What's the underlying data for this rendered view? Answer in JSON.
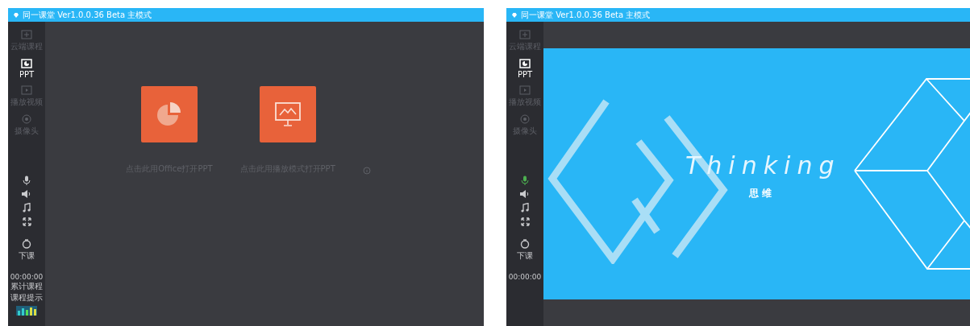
{
  "windows": [
    {
      "title": "同一课堂 Ver1.0.0.36 Beta  主模式",
      "sidebar": {
        "items": [
          {
            "label": "云端课程",
            "kind": "cloud",
            "selected": false
          },
          {
            "label": "PPT",
            "kind": "ppt",
            "selected": true
          },
          {
            "label": "播放视频",
            "kind": "video",
            "selected": false
          },
          {
            "label": "摄像头",
            "kind": "camera",
            "selected": false
          }
        ],
        "tools": [
          {
            "kind": "mic",
            "on": false
          },
          {
            "kind": "speaker",
            "on": false
          },
          {
            "kind": "music",
            "on": false
          },
          {
            "kind": "fullscreen",
            "on": false
          }
        ],
        "end_label": "下课",
        "timer": "00:00:00",
        "notes": [
          "累计课程",
          "课程提示"
        ]
      },
      "main": {
        "kind": "launcher",
        "options": [
          {
            "kind": "pie",
            "caption": "点击此用Office打开PPT"
          },
          {
            "kind": "monitor",
            "caption": "点击此用播放模式打开PPT"
          }
        ]
      }
    },
    {
      "title": "同一课堂 Ver1.0.0.36 Beta  主模式",
      "sidebar": {
        "items": [
          {
            "label": "云端课程",
            "kind": "cloud",
            "selected": false
          },
          {
            "label": "PPT",
            "kind": "ppt",
            "selected": true
          },
          {
            "label": "播放视频",
            "kind": "video",
            "selected": false
          },
          {
            "label": "摄像头",
            "kind": "camera",
            "selected": false
          }
        ],
        "tools": [
          {
            "kind": "mic",
            "on": true
          },
          {
            "kind": "speaker",
            "on": false
          },
          {
            "kind": "music",
            "on": false
          },
          {
            "kind": "fullscreen",
            "on": false
          }
        ],
        "end_label": "下课",
        "timer": "00:00:00"
      },
      "main": {
        "kind": "slide",
        "title": "Thinking",
        "subtitle": "思 维"
      }
    }
  ]
}
